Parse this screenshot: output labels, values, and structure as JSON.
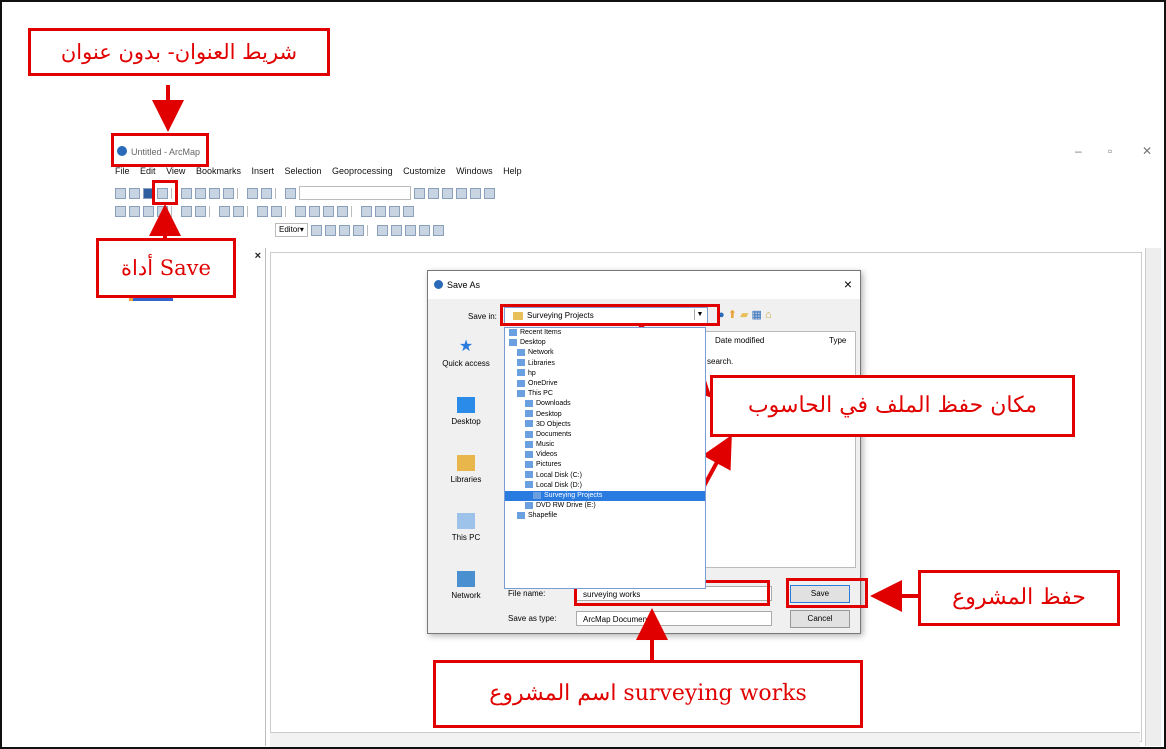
{
  "window": {
    "title": "Untitled - ArcMap",
    "menu": [
      "File",
      "Edit",
      "View",
      "Bookmarks",
      "Insert",
      "Selection",
      "Geoprocessing",
      "Customize",
      "Windows",
      "Help"
    ],
    "editor_label": "Editor▾"
  },
  "dialog": {
    "title": "Save As",
    "close": "×",
    "save_in_label": "Save in:",
    "save_in_value": "Surveying Projects",
    "places": [
      "Quick access",
      "Desktop",
      "Libraries",
      "This PC",
      "Network"
    ],
    "columns": {
      "date": "Date modified",
      "type": "Type"
    },
    "search_hint": "search.",
    "dropdown_items": [
      {
        "label": "Recent Items",
        "indent": 0,
        "selected": false
      },
      {
        "label": "Desktop",
        "indent": 0,
        "selected": false
      },
      {
        "label": "Network",
        "indent": 1,
        "selected": false
      },
      {
        "label": "Libraries",
        "indent": 1,
        "selected": false
      },
      {
        "label": "hp",
        "indent": 1,
        "selected": false
      },
      {
        "label": "OneDrive",
        "indent": 1,
        "selected": false
      },
      {
        "label": "This PC",
        "indent": 1,
        "selected": false
      },
      {
        "label": "Downloads",
        "indent": 2,
        "selected": false
      },
      {
        "label": "Desktop",
        "indent": 2,
        "selected": false
      },
      {
        "label": "3D Objects",
        "indent": 2,
        "selected": false
      },
      {
        "label": "Documents",
        "indent": 2,
        "selected": false
      },
      {
        "label": "Music",
        "indent": 2,
        "selected": false
      },
      {
        "label": "Videos",
        "indent": 2,
        "selected": false
      },
      {
        "label": "Pictures",
        "indent": 2,
        "selected": false
      },
      {
        "label": "Local Disk (C:)",
        "indent": 2,
        "selected": false
      },
      {
        "label": "Local Disk (D:)",
        "indent": 2,
        "selected": false
      },
      {
        "label": "Surveying Projects",
        "indent": 3,
        "selected": true
      },
      {
        "label": "DVD RW Drive (E:)",
        "indent": 2,
        "selected": false
      },
      {
        "label": "Shapefile",
        "indent": 1,
        "selected": false
      }
    ],
    "file_name_label": "File name:",
    "file_name_value": "surveying works",
    "save_type_label": "Save as type:",
    "save_type_value": "ArcMap Documen",
    "save_button": "Save",
    "cancel_button": "Cancel"
  },
  "annotations": {
    "title_bar": "شريط العنوان- بدون عنوان",
    "save_tool": "أداة Save",
    "save_location": "مكان حفظ الملف في الحاسوب",
    "save_project": "حفظ المشروع",
    "project_name": "اسم المشروع surveying works"
  },
  "colors": {
    "annotation": "#e00000",
    "selection": "#2a7be0"
  }
}
